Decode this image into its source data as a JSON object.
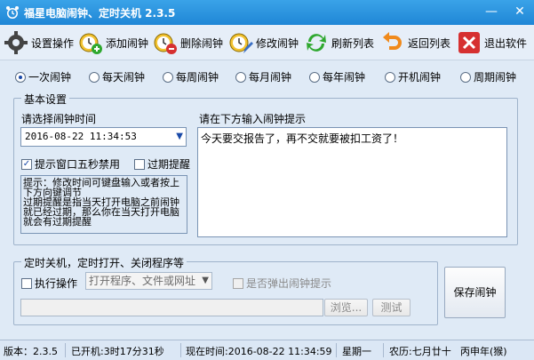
{
  "window": {
    "title": "福星电脑闹钟、定时关机 2.3.5",
    "minimize_glyph": "—",
    "close_glyph": "✕",
    "accent": "#2b92dd"
  },
  "toolbar": {
    "items": [
      {
        "label": "设置操作",
        "icon": "gear-icon"
      },
      {
        "label": "添加闹钟",
        "icon": "alarm-clock-add-icon"
      },
      {
        "label": "删除闹钟",
        "icon": "alarm-clock-delete-icon"
      },
      {
        "label": "修改闹钟",
        "icon": "alarm-clock-edit-icon"
      },
      {
        "label": "刷新列表",
        "icon": "refresh-icon"
      },
      {
        "label": "返回列表",
        "icon": "return-arrow-icon"
      },
      {
        "label": "退出软件",
        "icon": "exit-icon"
      }
    ]
  },
  "alarm_types": {
    "selected_index": 0,
    "options": [
      "一次闹钟",
      "每天闹钟",
      "每周闹钟",
      "每月闹钟",
      "每年闹钟",
      "开机闹钟",
      "周期闹钟"
    ]
  },
  "basic": {
    "legend": "基本设置",
    "time_label": "请选择闹钟时间",
    "time_value": "2016-08-22  11:34:53",
    "popup_checkbox": {
      "label": "提示窗口五秒禁用",
      "checked": true
    },
    "overdue_checkbox": {
      "label": "过期提醒",
      "checked": false
    },
    "hint_text": "提示：修改时间可键盘输入或者按上下方向键调节\n过期提醒是指当天打开电脑之前闹钟就已经过期，那么你在当天打开电脑就会有过期提醒",
    "message_label": "请在下方输入闹钟提示",
    "message_value": "今天要交报告了，再不交就要被扣工资了！"
  },
  "shutdown": {
    "legend": "定时关机，定时打开、关闭程序等",
    "execute_checkbox": {
      "label": "执行操作",
      "checked": false
    },
    "program_select": "打开程序、文件或网址",
    "popup_alarm_checkbox": {
      "label": "是否弹出闹钟提示",
      "checked": false
    },
    "path_value": "",
    "browse_label": "浏览...",
    "test_label": "测试",
    "save_label": "保存闹钟"
  },
  "status": {
    "version": "版本：2.3.5",
    "uptime": "已开机:3时17分31秒",
    "now": "现在时间:2016-08-22 11:34:59",
    "weekday": "星期一",
    "lunar": "农历:七月廿十",
    "ganzhi": "丙申年(猴)"
  }
}
